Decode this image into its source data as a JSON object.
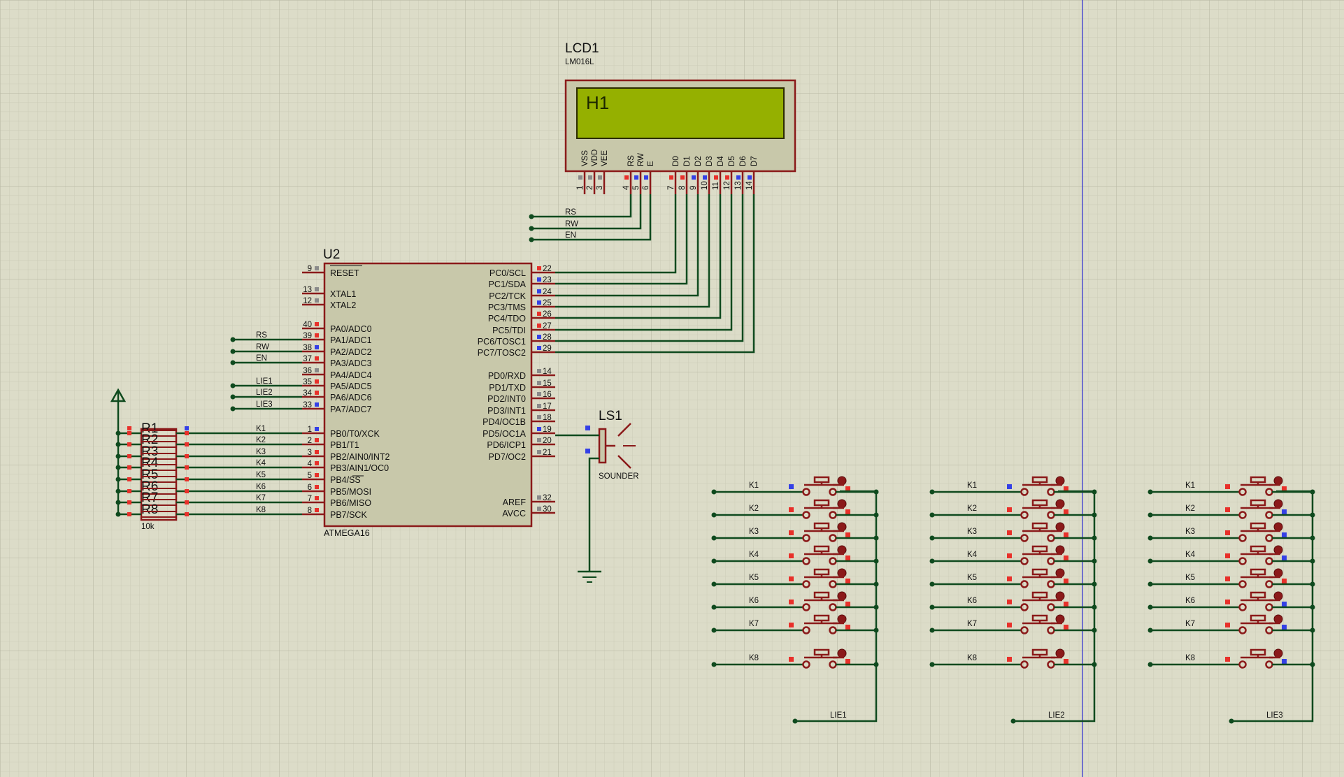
{
  "lcd": {
    "ref": "LCD1",
    "part": "LM016L",
    "screen_text": "H1",
    "pin_labels": [
      "VSS",
      "VDD",
      "VEE",
      "RS",
      "RW",
      "E",
      "D0",
      "D1",
      "D2",
      "D3",
      "D4",
      "D5",
      "D6",
      "D7"
    ],
    "pin_numbers": [
      "1",
      "2",
      "3",
      "4",
      "5",
      "6",
      "7",
      "8",
      "9",
      "10",
      "11",
      "12",
      "13",
      "14"
    ],
    "net_labels": [
      "RS",
      "RW",
      "EN"
    ]
  },
  "mcu": {
    "ref": "U2",
    "part": "ATMEGA16",
    "left_pins": [
      {
        "name": "RESET",
        "num": "9"
      },
      {
        "name": "XTAL1",
        "num": "13"
      },
      {
        "name": "XTAL2",
        "num": "12"
      },
      {
        "name": "PA0/ADC0",
        "num": "40"
      },
      {
        "name": "PA1/ADC1",
        "num": "39"
      },
      {
        "name": "PA2/ADC2",
        "num": "38"
      },
      {
        "name": "PA3/ADC3",
        "num": "37"
      },
      {
        "name": "PA4/ADC4",
        "num": "36"
      },
      {
        "name": "PA5/ADC5",
        "num": "35"
      },
      {
        "name": "PA6/ADC6",
        "num": "34"
      },
      {
        "name": "PA7/ADC7",
        "num": "33"
      },
      {
        "name": "PB0/T0/XCK",
        "num": "1"
      },
      {
        "name": "PB1/T1",
        "num": "2"
      },
      {
        "name": "PB2/AIN0/INT2",
        "num": "3"
      },
      {
        "name": "PB3/AIN1/OC0",
        "num": "4"
      },
      {
        "name": "PB4/SS",
        "num": "5"
      },
      {
        "name": "PB5/MOSI",
        "num": "6"
      },
      {
        "name": "PB6/MISO",
        "num": "7"
      },
      {
        "name": "PB7/SCK",
        "num": "8"
      }
    ],
    "right_pins": [
      {
        "name": "PC0/SCL",
        "num": "22"
      },
      {
        "name": "PC1/SDA",
        "num": "23"
      },
      {
        "name": "PC2/TCK",
        "num": "24"
      },
      {
        "name": "PC3/TMS",
        "num": "25"
      },
      {
        "name": "PC4/TDO",
        "num": "26"
      },
      {
        "name": "PC5/TDI",
        "num": "27"
      },
      {
        "name": "PC6/TOSC1",
        "num": "28"
      },
      {
        "name": "PC7/TOSC2",
        "num": "29"
      },
      {
        "name": "PD0/RXD",
        "num": "14"
      },
      {
        "name": "PD1/TXD",
        "num": "15"
      },
      {
        "name": "PD2/INT0",
        "num": "16"
      },
      {
        "name": "PD3/INT1",
        "num": "17"
      },
      {
        "name": "PD4/OC1B",
        "num": "18"
      },
      {
        "name": "PD5/OC1A",
        "num": "19"
      },
      {
        "name": "PD6/ICP1",
        "num": "20"
      },
      {
        "name": "PD7/OC2",
        "num": "21"
      },
      {
        "name": "AREF",
        "num": "32"
      },
      {
        "name": "AVCC",
        "num": "30"
      }
    ],
    "pa_net_labels": [
      "RS",
      "RW",
      "EN",
      "LIE1",
      "LIE2",
      "LIE3"
    ],
    "pb_net_labels": [
      "K1",
      "K2",
      "K3",
      "K4",
      "K5",
      "K6",
      "K7",
      "K8"
    ]
  },
  "resistors": {
    "labels": [
      "R1",
      "R2",
      "R3",
      "R4",
      "R5",
      "R6",
      "R7",
      "R8"
    ],
    "value": "10k"
  },
  "sounder": {
    "ref": "LS1",
    "part": "SOUNDER"
  },
  "keypads": [
    {
      "column_label": "LIE1",
      "rows": [
        "K1",
        "K2",
        "K3",
        "K4",
        "K5",
        "K6",
        "K7",
        "K8"
      ]
    },
    {
      "column_label": "LIE2",
      "rows": [
        "K1",
        "K2",
        "K3",
        "K4",
        "K5",
        "K6",
        "K7",
        "K8"
      ]
    },
    {
      "column_label": "LIE3",
      "rows": [
        "K1",
        "K2",
        "K3",
        "K4",
        "K5",
        "K6",
        "K7",
        "K8"
      ]
    }
  ],
  "colors": {
    "background": "#dcdcc8",
    "grid_minor": "#c9c9b4",
    "grid_major": "#b9b9a4",
    "wire": "#0f4a1e",
    "component": "#8b1a1a",
    "body_fill": "#c8c8aa",
    "lcd_screen": "#95b000",
    "pin_red": "#e8302a",
    "pin_blue": "#3440e6",
    "pin_gray": "#8a8a8a",
    "cursor_line": "#2a2ad0",
    "text": "#111111"
  }
}
